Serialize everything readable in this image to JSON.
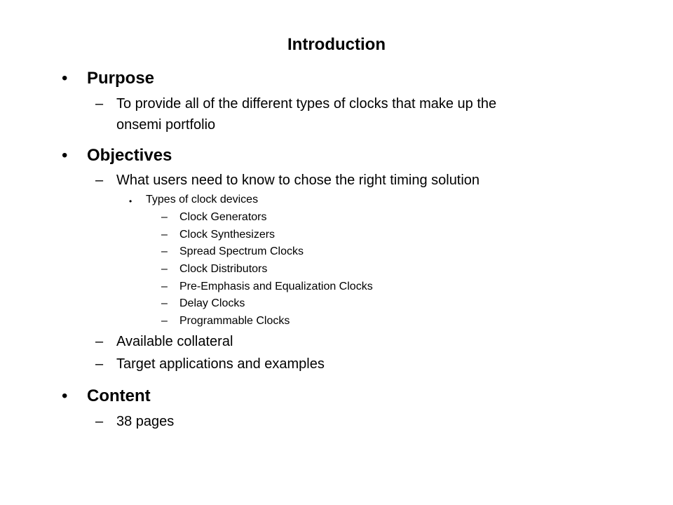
{
  "slide": {
    "title": "Introduction",
    "bullet_glyph": "•",
    "dash_glyph": "–",
    "sections": [
      {
        "heading": "Purpose",
        "items": [
          {
            "text_line1": "To provide all of the different types of clocks that make up the",
            "text_line2": "onsemi portfolio"
          }
        ]
      },
      {
        "heading": "Objectives",
        "items": [
          {
            "text": "What users need to know to chose the right timing solution",
            "sub_heading": "Types of clock devices",
            "sub_items": [
              "Clock Generators",
              "Clock Synthesizers",
              "Spread Spectrum Clocks",
              "Clock Distributors",
              "Pre-Emphasis and Equalization Clocks",
              "Delay Clocks",
              "Programmable Clocks"
            ]
          },
          {
            "text": "Available collateral"
          },
          {
            "text": "Target applications and examples"
          }
        ]
      },
      {
        "heading": "Content",
        "items": [
          {
            "text": "38 pages"
          }
        ]
      }
    ]
  }
}
